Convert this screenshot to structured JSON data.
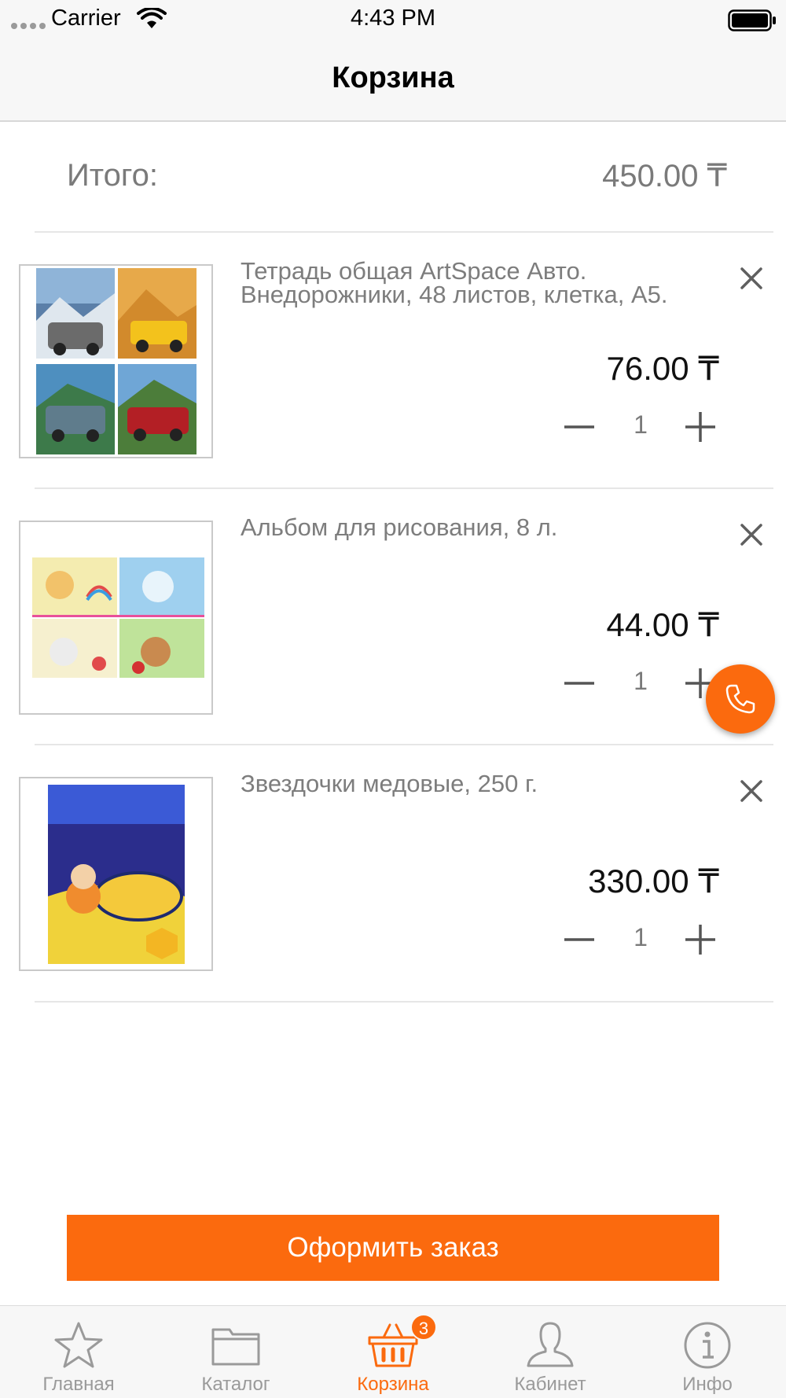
{
  "status_bar": {
    "carrier": "Carrier",
    "time": "4:43 PM"
  },
  "nav": {
    "title": "Корзина"
  },
  "summary": {
    "total_label": "Итого:",
    "total_value": "450.00 ₸"
  },
  "items": [
    {
      "name": "Тетрадь общая ArtSpace Авто. Внедорожники, 48 листов, клетка, А5.",
      "price": "76.00 ₸",
      "quantity": "1",
      "image": "notebooks-vehicles"
    },
    {
      "name": "Альбом для рисования, 8 л.",
      "price": "44.00 ₸",
      "quantity": "1",
      "image": "drawing-albums"
    },
    {
      "name": "Звездочки медовые, 250 г.",
      "price": "330.00 ₸",
      "quantity": "1",
      "image": "pause-stars-cereal"
    }
  ],
  "checkout": {
    "label": "Оформить заказ"
  },
  "tabs": [
    {
      "label": "Главная",
      "icon": "star-icon"
    },
    {
      "label": "Каталог",
      "icon": "folder-icon"
    },
    {
      "label": "Корзина",
      "icon": "basket-icon",
      "badge": "3",
      "active": true
    },
    {
      "label": "Кабинет",
      "icon": "person-icon"
    },
    {
      "label": "Инфо",
      "icon": "info-icon"
    }
  ],
  "colors": {
    "accent": "#fb6a0e",
    "secondary_text": "#7d7d7d",
    "bar_background": "#f7f7f7"
  }
}
